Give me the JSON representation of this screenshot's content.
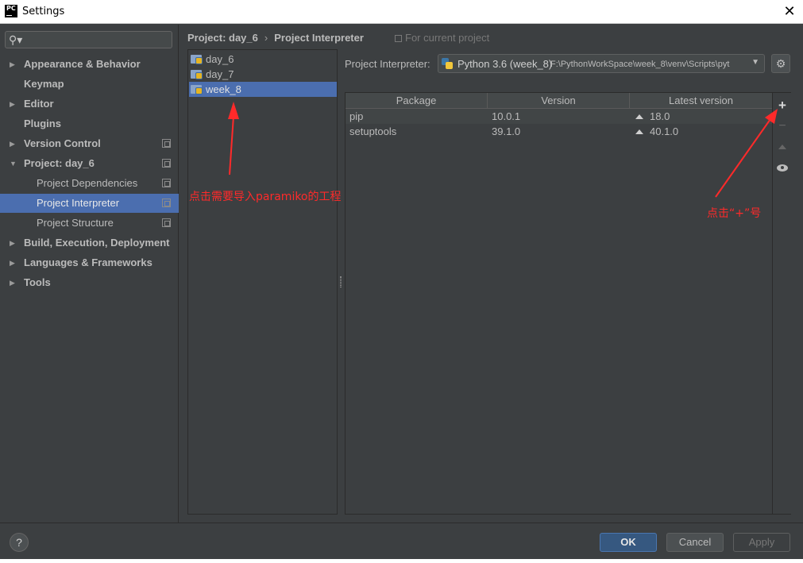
{
  "window": {
    "app_logo": "PC",
    "title": "Settings",
    "close_glyph": "✕"
  },
  "search": {
    "value": "",
    "placeholder": ""
  },
  "sidebar": {
    "items": [
      {
        "label": "Appearance & Behavior",
        "arrow": "▶"
      },
      {
        "label": "Keymap",
        "arrow": ""
      },
      {
        "label": "Editor",
        "arrow": "▶"
      },
      {
        "label": "Plugins",
        "arrow": ""
      },
      {
        "label": "Version Control",
        "arrow": "▶"
      },
      {
        "label": "Project: day_6",
        "arrow": "▼"
      },
      {
        "label": "Project Dependencies",
        "arrow": ""
      },
      {
        "label": "Project Interpreter",
        "arrow": ""
      },
      {
        "label": "Project Structure",
        "arrow": ""
      },
      {
        "label": "Build, Execution, Deployment",
        "arrow": "▶"
      },
      {
        "label": "Languages & Frameworks",
        "arrow": "▶"
      },
      {
        "label": "Tools",
        "arrow": "▶"
      }
    ],
    "selected": "Project Interpreter"
  },
  "breadcrumb": {
    "project": "Project: day_6",
    "separator": "›",
    "page": "Project Interpreter"
  },
  "for_current_project": "For current project",
  "projects": {
    "items": [
      "day_6",
      "day_7",
      "week_8"
    ],
    "selected": "week_8"
  },
  "interpreter": {
    "label": "Project Interpreter:",
    "name": "Python 3.6 (week_8)",
    "path": "F:\\PythonWorkSpace\\week_8\\venv\\Scripts\\pyt",
    "dropdown_glyph": "▼",
    "settings_glyph": "⚙"
  },
  "packages": {
    "columns": [
      "Package",
      "Version",
      "Latest version"
    ],
    "rows": [
      {
        "package": "pip",
        "version": "10.0.1",
        "latest": "18.0"
      },
      {
        "package": "setuptools",
        "version": "39.1.0",
        "latest": "40.1.0"
      }
    ],
    "tools": {
      "add": "+",
      "remove": "−"
    }
  },
  "annotations": {
    "left": "点击需要导入paramiko的工程",
    "right": "点击“+”号",
    "color": "#ff2a2a"
  },
  "footer": {
    "help": "?",
    "ok": "OK",
    "cancel": "Cancel",
    "apply": "Apply"
  },
  "colors": {
    "background": "#3c3f41",
    "selection": "#4b6eaf",
    "ok_button": "#365880"
  }
}
